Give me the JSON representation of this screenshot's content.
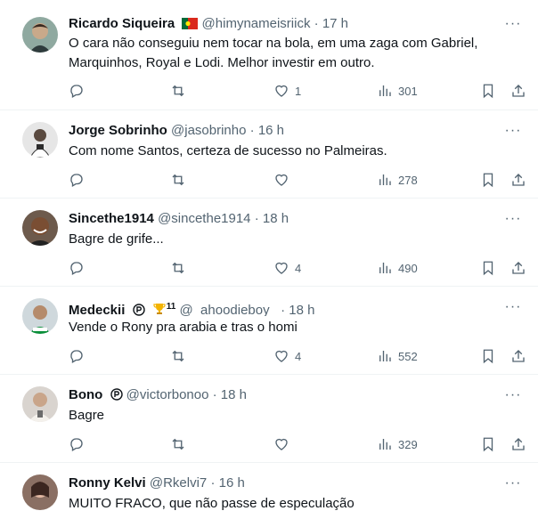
{
  "tweets": [
    {
      "name": "Ricardo Siqueira",
      "badge": "flag-portugal",
      "handle": "@himynameisriick",
      "time": "17 h",
      "text_lines": [
        "O cara não conseguiu nem tocar na bola, em uma zaga com Gabriel,",
        "Marquinhos, Royal e Lodi. Melhor investir em outro."
      ],
      "likes": "1",
      "views": "301"
    },
    {
      "name": "Jorge Sobrinho",
      "handle": "@jasobrinho",
      "time": "16 h",
      "text_lines": [
        "Com nome Santos, certeza de sucesso no Palmeiras."
      ],
      "likes": "",
      "views": "278"
    },
    {
      "name": "Sincethe1914",
      "handle": "@sincethe1914",
      "time": "18 h",
      "text_lines": [
        "Bagre de grife..."
      ],
      "likes": "4",
      "views": "490"
    },
    {
      "name": "Medeckii",
      "badge": "trophy",
      "badge_count": "11",
      "handle": "@_ahoodieboy_",
      "time": "18 h",
      "text_lines": [
        "Vende o Rony pra arabia e tras o homi"
      ],
      "likes": "4",
      "views": "552"
    },
    {
      "name": "Bono",
      "handle": "@victorbonoo",
      "time": "18 h",
      "text_lines": [
        "Bagre"
      ],
      "likes": "",
      "views": "329"
    },
    {
      "name": "Ronny Kelvi",
      "handle": "@Rkelvi7",
      "time": "16 h",
      "text_lines": [
        "MUITO FRACO, que não passe de especulação"
      ],
      "likes": "",
      "views": ""
    }
  ],
  "separator": "·",
  "more_label": "···",
  "icons": [
    "reply-icon",
    "retweet-icon",
    "like-icon",
    "views-icon",
    "bookmark-icon",
    "share-icon",
    "more-icon"
  ]
}
